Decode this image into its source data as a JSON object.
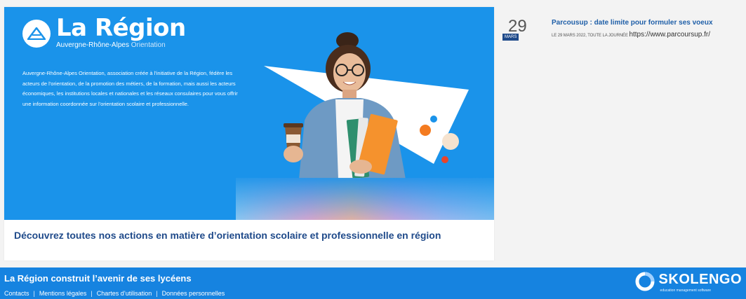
{
  "banner": {
    "logo": {
      "title": "La Région",
      "subtitle": "Auvergne-Rhône-Alpes",
      "subtitle_suffix": "Orientation"
    },
    "intro_text": "Auvergne-Rhône-Alpes Orientation, association créée à l'initiative de la Région, fédère les acteurs de l'orientation, de la promotion des métiers, de la formation, mais aussi les acteurs économiques, les institutions locales et nationales et les réseaux consulaires pour vous offrir une information coordonnée sur l'orientation scolaire et professionnelle.",
    "caption": "Découvrez toutes nos actions en matière d’orientation scolaire et professionnelle en région",
    "colors": {
      "primary": "#1a93ea",
      "caption": "#1f4a8a"
    }
  },
  "events": [
    {
      "day": "29",
      "month": "MARS",
      "title": "Parcousup : date limite pour formuler ses voeux",
      "meta": "LE 29 MARS 2022, TOUTE LA JOURNÉE",
      "link": "https://www.parcoursup.fr/"
    }
  ],
  "footer": {
    "title": "La Région construit l’avenir de ses lycéens",
    "links": [
      "Contacts",
      "Mentions légales",
      "Chartes d’utilisation",
      "Données personnelles"
    ],
    "separator": "|",
    "brand": {
      "name": "SKOLENGO",
      "tagline": "education management software"
    },
    "color": "#1683e0"
  }
}
